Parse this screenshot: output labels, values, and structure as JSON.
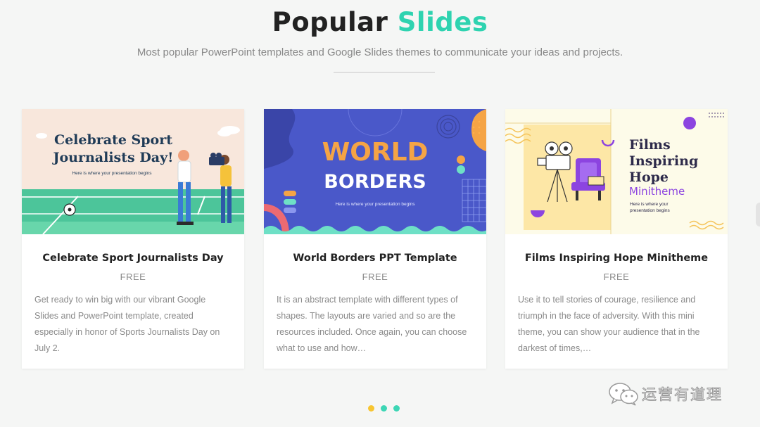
{
  "header": {
    "title_part1": "Popular",
    "title_part2": "Slides",
    "subtitle": "Most popular PowerPoint templates and Google Slides themes to communicate your ideas and projects."
  },
  "colors": {
    "accent": "#2ed3b0",
    "dot_active": "#f7c531",
    "dot_inactive": "#3dd6b5"
  },
  "cards": [
    {
      "title": "Celebrate Sport Journalists Day",
      "price": "FREE",
      "description": "Get ready to win big with our vibrant Google Slides and PowerPoint template, created especially in honor of Sports Journalists Day on July 2.",
      "thumb": {
        "heading_line1": "Celebrate Sport",
        "heading_line2": "Journalists Day!",
        "tagline": "Here is where your presentation begins"
      }
    },
    {
      "title": "World Borders PPT Template",
      "price": "FREE",
      "description": "It is an abstract template with different types of shapes. The layouts are varied and so are the resources included. Once again, you can choose what to use and how…",
      "thumb": {
        "heading_line1": "WORLD",
        "heading_line2": "BORDERS",
        "tagline": "Here is where your presentation begins"
      }
    },
    {
      "title": "Films Inspiring Hope Minitheme",
      "price": "FREE",
      "description": "Use it to tell stories of courage, resilience and triumph in the face of adversity. With this mini theme, you can show your audience that in the darkest of times,…",
      "thumb": {
        "heading_line1": "Films",
        "heading_line2": "Inspiring",
        "heading_line3": "Hope",
        "heading_line4": "Minitheme",
        "tagline_line1": "Here is where your",
        "tagline_line2": "presentation begins"
      }
    }
  ],
  "carousel": {
    "pages": 3,
    "active_index": 0
  },
  "watermark": {
    "text": "运营有道理",
    "icon": "wechat-icon"
  }
}
